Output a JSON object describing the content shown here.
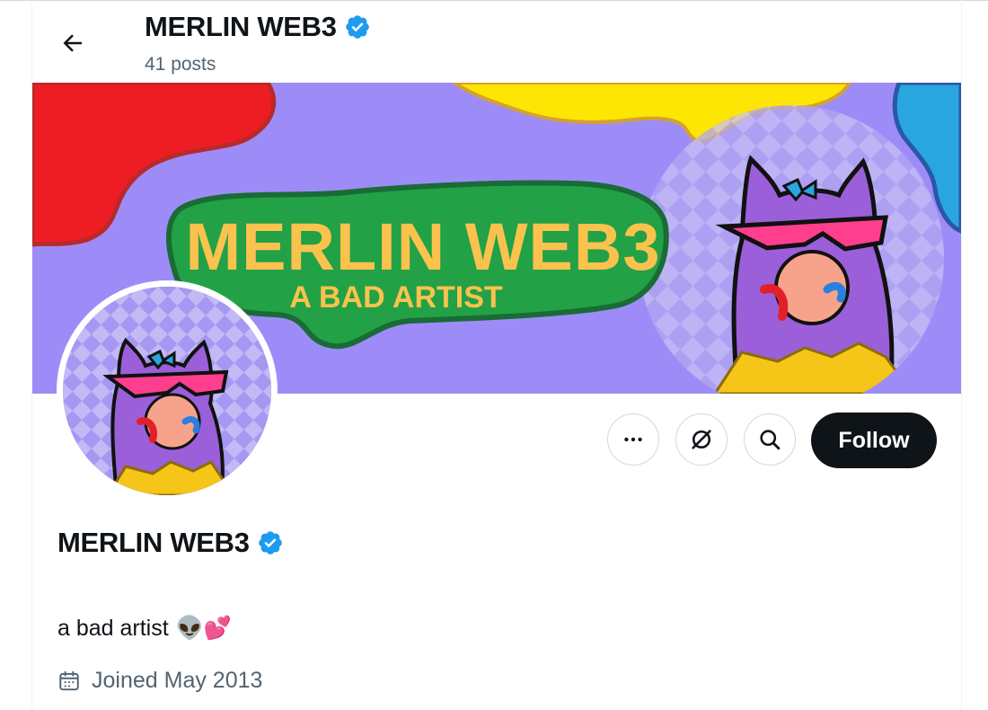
{
  "header": {
    "back_icon": "arrow-left-icon",
    "name": "MERLIN WEB3",
    "verified_icon": "verified-badge-icon",
    "posts": "41 posts"
  },
  "banner": {
    "title_line1": "MERLIN WEB3",
    "title_line2": "A BAD ARTIST"
  },
  "actions": {
    "more_icon": "more-horizontal-icon",
    "grok_icon": "grok-icon",
    "search_icon": "search-icon",
    "follow_label": "Follow"
  },
  "profile": {
    "name": "MERLIN WEB3",
    "bio": "a bad artist",
    "bio_emoji": "👽💕",
    "joined_icon": "calendar-icon",
    "joined": "Joined May 2013"
  },
  "colors": {
    "verified": "#1d9bf0",
    "banner_bg": "#9d8cf8",
    "banner_green": "#22a146",
    "banner_text": "#fbc24d",
    "follow_bg": "#0f1419"
  }
}
